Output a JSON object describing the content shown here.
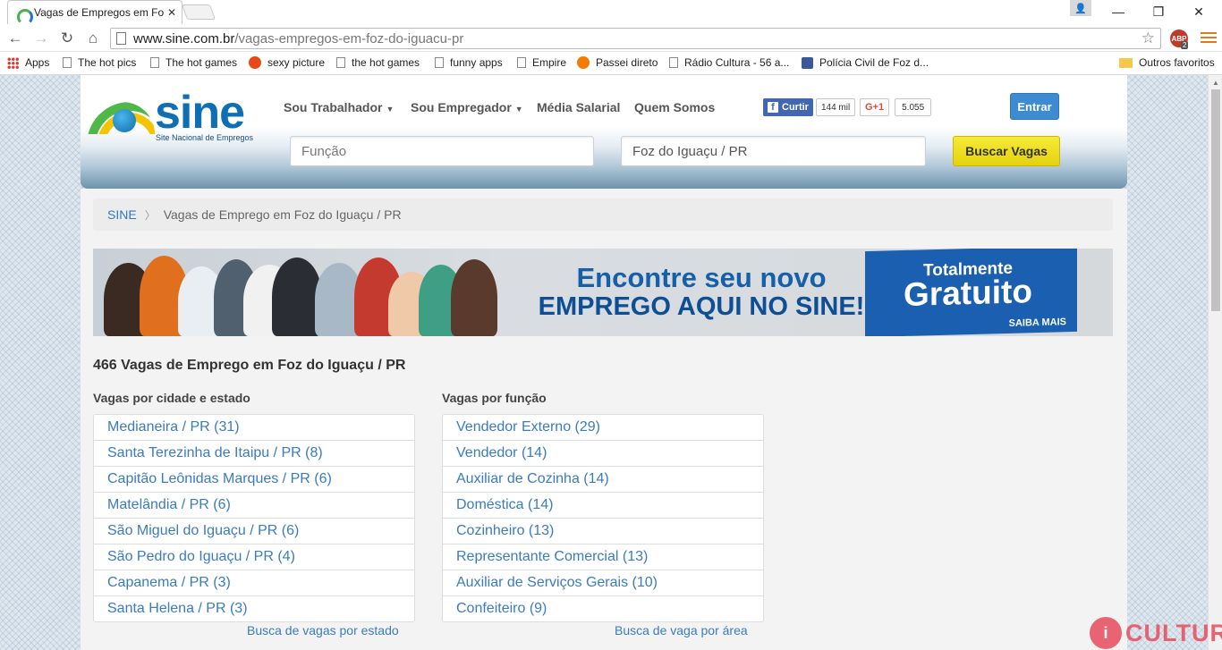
{
  "browser": {
    "tab_title": "Vagas de Empregos em Fo",
    "url_host": "www.sine.com.br",
    "url_path": "/vagas-empregos-em-foz-do-iguacu-pr",
    "abp_label": "ABP",
    "abp_count": "2",
    "bookmarks": [
      "Apps",
      "The hot pics",
      "The hot games",
      "sexy picture",
      "the hot games",
      "funny apps",
      "Empire",
      "Passei direto",
      "Rádio Cultura - 56 a...",
      "Polícia Civil de Foz d..."
    ],
    "other_bookmarks": "Outros favoritos"
  },
  "header": {
    "logo_word": "sine",
    "logo_sub": "Site Nacional de Empregos",
    "nav": [
      "Sou Trabalhador",
      "Sou Empregador",
      "Média Salarial",
      "Quem Somos"
    ],
    "fb_like": "Curtir",
    "fb_count": "144 mil",
    "gplus_label": "G+1",
    "gplus_count": "5.055",
    "login_label": "Entrar",
    "search_function_placeholder": "Função",
    "search_city_value": "Foz do Iguaçu / PR",
    "search_button": "Buscar Vagas"
  },
  "breadcrumb": {
    "home": "SINE",
    "separator": "〉",
    "current": "Vagas de Emprego em Foz do Iguaçu / PR"
  },
  "banner": {
    "line1": "Encontre seu novo",
    "line2": "EMPREGO AQUI NO SINE!",
    "badge_top": "Totalmente",
    "badge_main": "Gratuito",
    "badge_link": "SAIBA MAIS"
  },
  "results": {
    "title": "466 Vagas de Emprego em Foz do Iguaçu / PR",
    "by_city_title": "Vagas por cidade e estado",
    "by_city": [
      "Medianeira / PR (31)",
      "Santa Terezinha de Itaipu / PR (8)",
      "Capitão Leônidas Marques / PR (6)",
      "Matelândia / PR (6)",
      "São Miguel do Iguaçu / PR (6)",
      "São Pedro do Iguaçu / PR (4)",
      "Capanema / PR (3)",
      "Santa Helena / PR (3)"
    ],
    "by_city_more": "Busca de vagas por estado",
    "by_function_title": "Vagas por função",
    "by_function": [
      "Vendedor Externo (29)",
      "Vendedor (14)",
      "Auxiliar de Cozinha (14)",
      "Doméstica (14)",
      "Cozinheiro (13)",
      "Representante Comercial (13)",
      "Auxiliar de Serviços Gerais (10)",
      "Confeiteiro (9)"
    ],
    "by_function_more": "Busca de vaga por área"
  },
  "watermark": "CULTURA",
  "colors": {
    "link": "#3b7bbf",
    "brand_blue": "#0f6fb3",
    "login_button": "#3d8bd0",
    "search_button": "#f6ea3a"
  }
}
